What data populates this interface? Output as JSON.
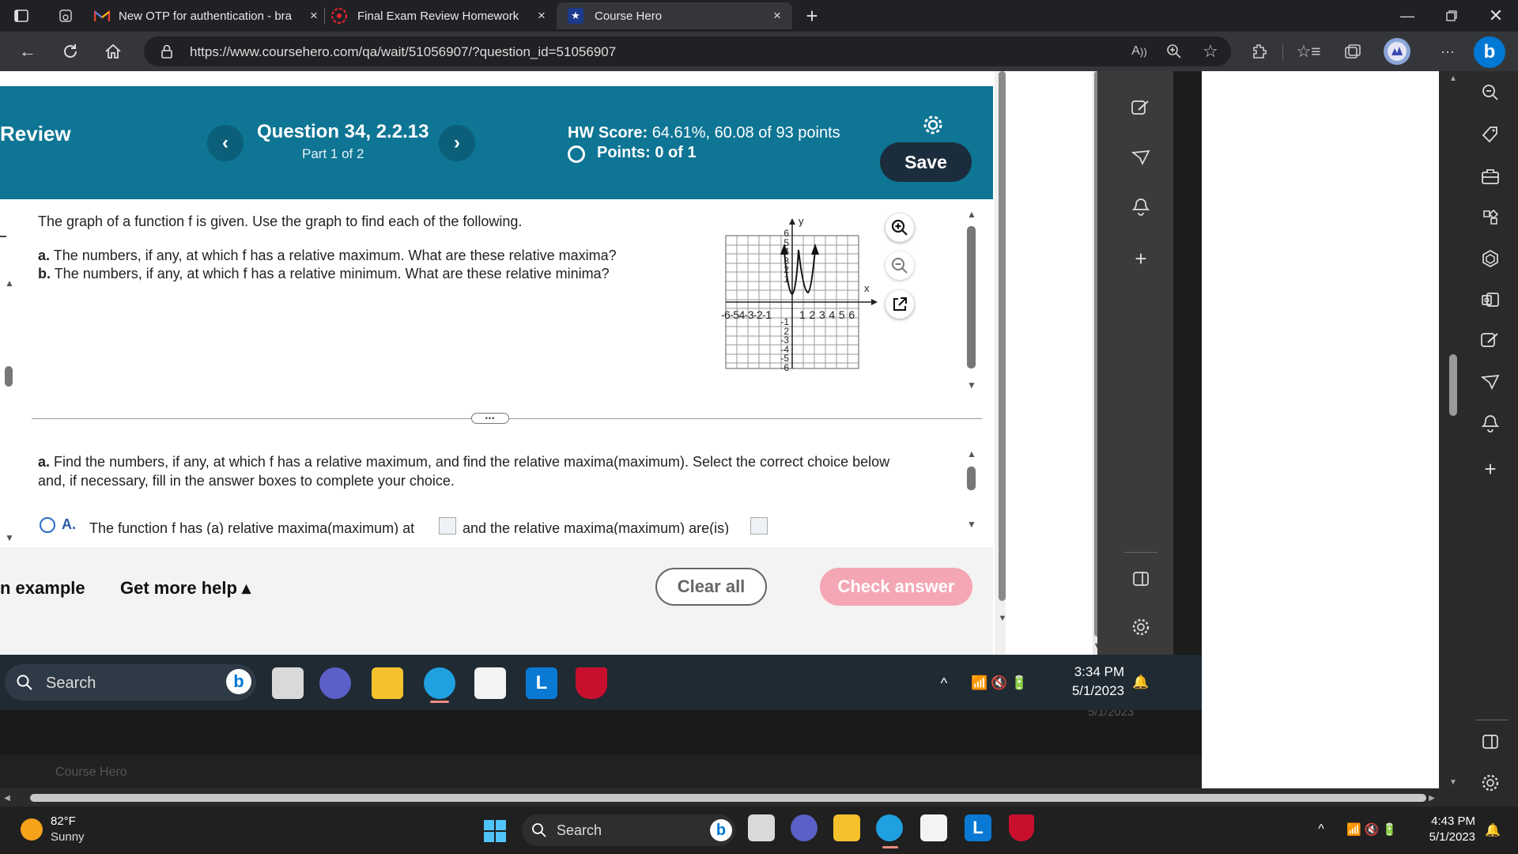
{
  "browser": {
    "tabs": [
      {
        "title": "New OTP for authentication - bra",
        "icon": "gmail-icon"
      },
      {
        "title": "Final Exam Review Homework",
        "icon": "mylab-icon"
      },
      {
        "title": "Course Hero",
        "icon": "coursehero-icon"
      }
    ],
    "url": "https://www.coursehero.com/qa/wait/51056907/?question_id=51056907",
    "inner_tab_title": "Course Hero"
  },
  "header": {
    "left_title": "Review",
    "question_title": "Question 34, 2.2.13",
    "part": "Part 1 of 2",
    "hw_score_label": "HW Score:",
    "hw_score_value": "64.61%, 60.08 of 93 points",
    "points_label": "Points:",
    "points_value": "0 of 1",
    "save_label": "Save",
    "prev_glyph": "‹",
    "next_glyph": "›"
  },
  "question": {
    "intro": "The graph of a function f is given. Use the graph to find each of the following.",
    "part_a_label": "a.",
    "part_a_text": "The numbers, if any, at which f has a relative maximum. What are these relative maxima?",
    "part_b_label": "b.",
    "part_b_text": "The numbers, if any, at which f has a relative minimum. What are these relative minima?",
    "ellipsis": "•••",
    "find_label": "a.",
    "find_text": "Find the numbers, if any, at which f has a relative maximum, and find the relative maxima(maximum). Select the correct choice below and, if necessary, fill in the answer boxes to complete your choice.",
    "choice_a_label": "A.",
    "choice_a_text1": "The function f has (a) relative maxima(maximum) at",
    "choice_a_text2": "and the relative maxima(maximum) are(is)"
  },
  "graph": {
    "y_label": "y",
    "x_label": "x",
    "x_neg_ticks": "-6-54-3-2-1",
    "x_pos_ticks": "1 2 3 4 5 6",
    "y_pos_ticks": [
      "6",
      "5",
      "4",
      "3",
      "2",
      "1"
    ],
    "y_neg_ticks": [
      "-1",
      "2",
      "-3",
      "-4",
      "-5",
      "-6"
    ]
  },
  "footer": {
    "example_label": "n example",
    "more_help_label": "Get more help ▴",
    "clear_label": "Clear all",
    "check_label": "Check answer"
  },
  "inner_taskbar": {
    "search_label": "Search",
    "time": "3:34 PM",
    "date": "5/1/2023",
    "ghost_date": "5/1/2023"
  },
  "taskbar": {
    "weather_temp": "82°F",
    "weather_desc": "Sunny",
    "search_label": "Search",
    "time": "4:43 PM",
    "date": "5/1/2023"
  },
  "colors": {
    "header_teal": "#0e7594",
    "save_dark": "#1b2d3d",
    "check_pink": "#f4a6b4",
    "edge_blue": "#0078d4"
  }
}
